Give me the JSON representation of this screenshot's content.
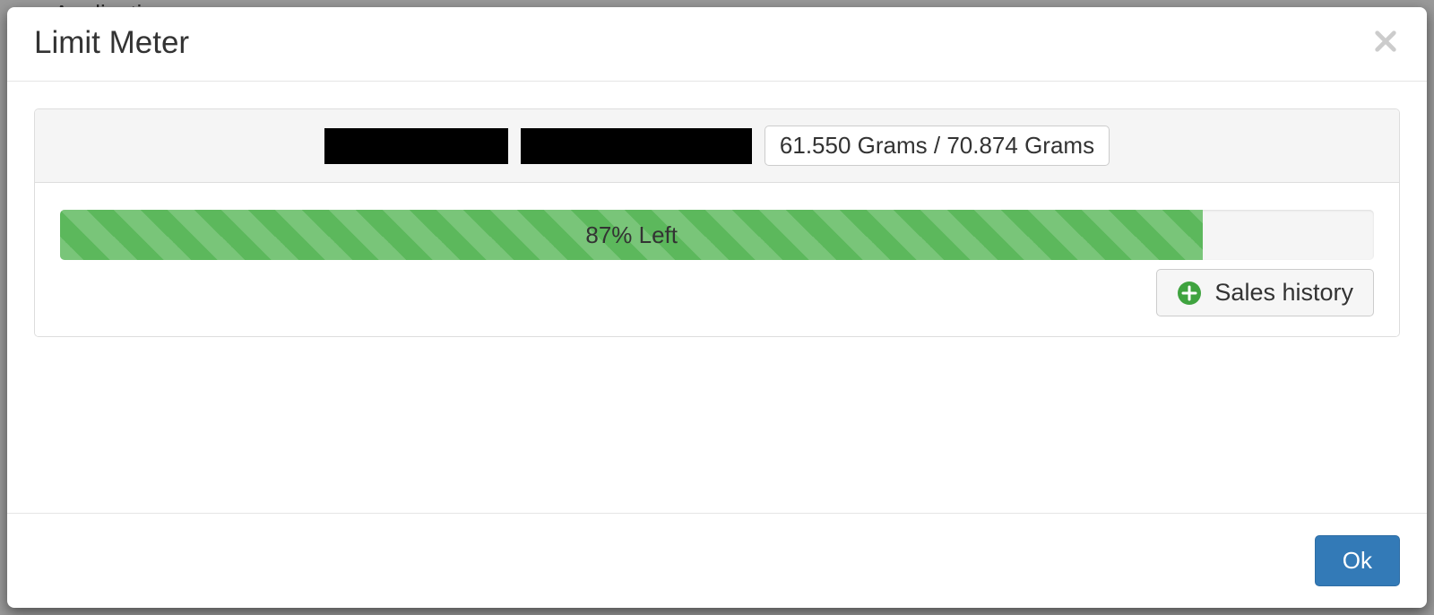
{
  "background": {
    "peek_text": "Applications"
  },
  "modal": {
    "title": "Limit Meter",
    "panel": {
      "grams_text": "61.550 Grams / 70.874 Grams",
      "progress": {
        "percent": 87,
        "label": "87% Left"
      },
      "sales_history_label": "Sales history"
    },
    "ok_label": "Ok"
  }
}
